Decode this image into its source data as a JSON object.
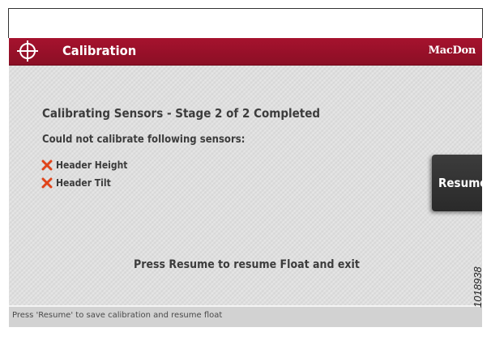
{
  "window": {
    "title": "Calibration",
    "brand": "MacDon",
    "title_icon": "crosshair-icon"
  },
  "main": {
    "heading": "Calibrating Sensors - Stage 2 of 2 Completed",
    "subheading": "Could not calibrate following sensors:",
    "failed_sensors": [
      {
        "label": "Header Height",
        "icon": "x-mark-icon"
      },
      {
        "label": "Header Tilt",
        "icon": "x-mark-icon"
      }
    ],
    "instruction": "Press Resume to resume Float and exit"
  },
  "buttons": {
    "resume_label": "Resume"
  },
  "status_bar": {
    "text": "Press 'Resume' to save calibration and resume float"
  },
  "document": {
    "figure_id": "1018938"
  },
  "colors": {
    "titlebar": "#9b1129",
    "error_x": "#e0441a",
    "screen_bg": "#dcdcdc",
    "text": "#3c3c3c",
    "button_bg": "#333333"
  }
}
